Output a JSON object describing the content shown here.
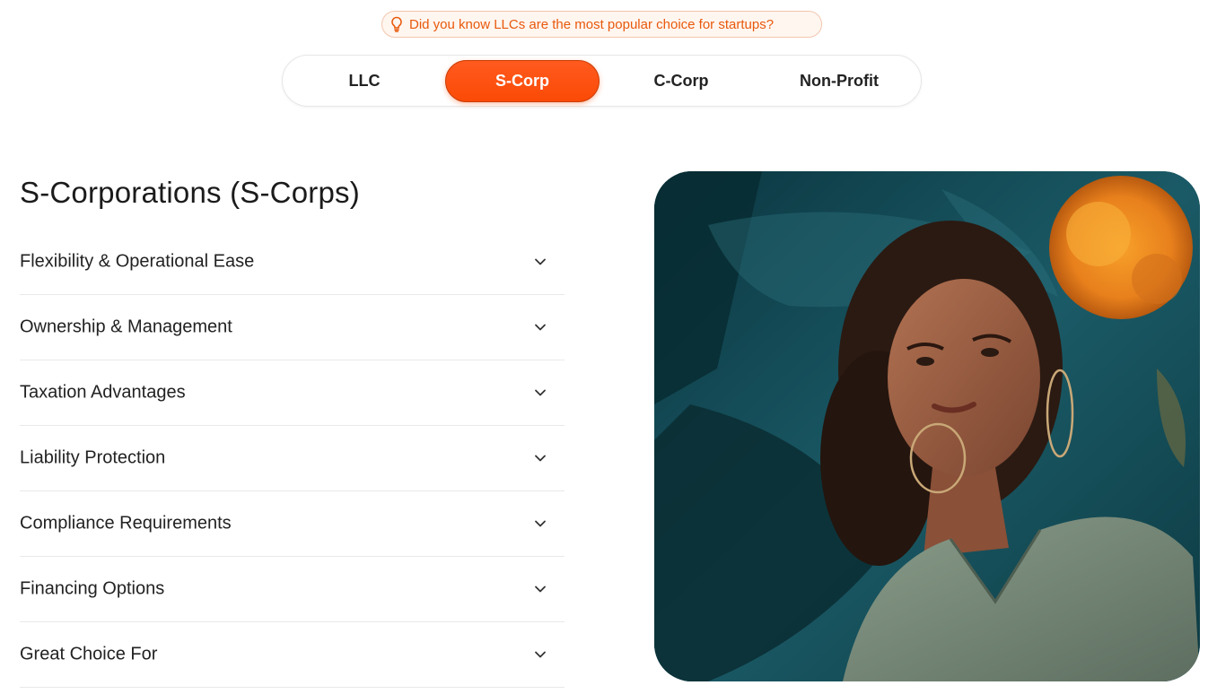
{
  "tip": {
    "icon": "lightbulb-icon",
    "text": "Did you know LLCs are the most popular choice for startups?"
  },
  "tabs": [
    {
      "label": "LLC",
      "active": false
    },
    {
      "label": "S-Corp",
      "active": true
    },
    {
      "label": "C-Corp",
      "active": false
    },
    {
      "label": "Non-Profit",
      "active": false
    }
  ],
  "section": {
    "title": "S-Corporations (S-Corps)",
    "items": [
      {
        "label": "Flexibility & Operational Ease"
      },
      {
        "label": "Ownership & Management"
      },
      {
        "label": "Taxation Advantages"
      },
      {
        "label": "Liability Protection"
      },
      {
        "label": "Compliance Requirements"
      },
      {
        "label": "Financing Options"
      },
      {
        "label": "Great Choice For"
      }
    ]
  },
  "colors": {
    "accent": "#fb4a06",
    "tip_text": "#e8590c"
  }
}
